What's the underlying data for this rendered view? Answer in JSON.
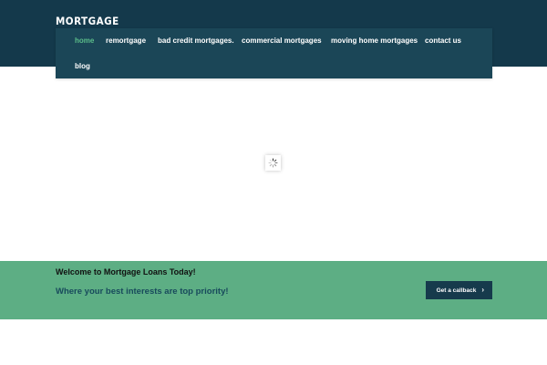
{
  "header": {
    "logo": "MORTGAGE",
    "nav": [
      {
        "label": "home",
        "active": true
      },
      {
        "label": "remortgage",
        "active": false
      },
      {
        "label": "bad credit mortgages.",
        "active": false
      },
      {
        "label": "commercial mortgages",
        "active": false
      },
      {
        "label": "moving home mortgages",
        "active": false
      },
      {
        "label": "contact us",
        "active": false
      },
      {
        "label": "blog",
        "active": false
      }
    ]
  },
  "loader": {
    "icon": "spinner-icon"
  },
  "banner": {
    "welcome": "Welcome to Mortgage Loans Today!",
    "tagline": "Where your best interests are top priority!",
    "cta_label": "Get a callback",
    "cta_icon": "chevron-right-icon"
  },
  "colors": {
    "header_bg": "#14394b",
    "nav_bg": "#1b4657",
    "accent": "#5bbd8a",
    "banner_bg": "#5dae84",
    "tagline": "#184a5c",
    "cta_bg": "#163a4c"
  }
}
